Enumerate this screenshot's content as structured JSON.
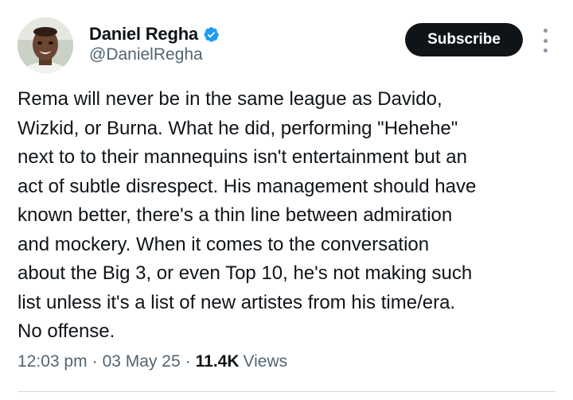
{
  "author": {
    "display_name": "Daniel Regha",
    "handle": "@DanielRegha",
    "verified_icon": "verified-badge-icon",
    "avatar_icon": "profile-photo"
  },
  "actions": {
    "subscribe_label": "Subscribe",
    "more_icon": "more-vertical-icon"
  },
  "tweet": {
    "lines": [
      "Rema will never be in the same league as Davido,",
      "Wizkid, or Burna. What he did, performing \"Hehehe\"",
      "next to to their mannequins isn't entertainment but an",
      "act of subtle disrespect. His management should have",
      "known better, there's a thin line between admiration",
      "and mockery. When it comes to the conversation",
      "about the Big 3, or even Top 10, he's not making such",
      "list unless it's a list of new artistes from his time/era.",
      "No offense."
    ]
  },
  "meta": {
    "time": "12:03 pm",
    "separator": "·",
    "date": "03 May 25",
    "views_count": "11.4K",
    "views_label": "Views"
  },
  "colors": {
    "primary_text": "#0f1419",
    "secondary_text": "#536471",
    "verified_blue": "#1d9bf0",
    "button_bg": "#0f1419"
  }
}
